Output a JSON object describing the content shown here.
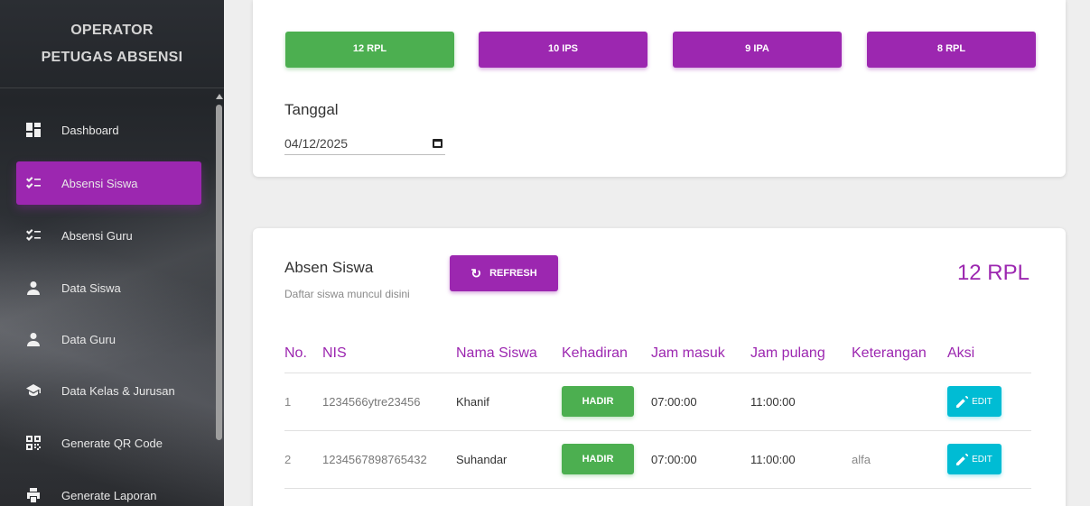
{
  "sidebar": {
    "brand_line1": "OPERATOR",
    "brand_line2": "PETUGAS ABSENSI",
    "items": [
      {
        "label": "Dashboard",
        "icon": "dashboard-icon"
      },
      {
        "label": "Absensi Siswa",
        "icon": "checklist-icon",
        "active": true
      },
      {
        "label": "Absensi Guru",
        "icon": "checklist-icon"
      },
      {
        "label": "Data Siswa",
        "icon": "person-icon"
      },
      {
        "label": "Data Guru",
        "icon": "person-icon"
      },
      {
        "label": "Data Kelas & Jurusan",
        "icon": "school-icon"
      },
      {
        "label": "Generate QR Code",
        "icon": "qr-code-icon"
      },
      {
        "label": "Generate Laporan",
        "icon": "printer-icon"
      }
    ]
  },
  "classes": [
    "12 RPL",
    "10 IPS",
    "9 IPA",
    "8 RPL"
  ],
  "date": {
    "label": "Tanggal",
    "value": "04/12/2025"
  },
  "absen": {
    "title": "Absen Siswa",
    "subtitle": "Daftar siswa muncul disini",
    "refresh_label": "REFRESH",
    "class_name": "12 RPL"
  },
  "table": {
    "headers": [
      "No.",
      "NIS",
      "Nama Siswa",
      "Kehadiran",
      "Jam masuk",
      "Jam pulang",
      "Keterangan",
      "Aksi"
    ],
    "rows": [
      {
        "no": "1",
        "nis": "1234566ytre23456",
        "nama": "Khanif",
        "kehadiran": "HADIR",
        "jam_masuk": "07:00:00",
        "jam_pulang": "11:00:00",
        "keterangan": "",
        "aksi": "EDIT"
      },
      {
        "no": "2",
        "nis": "1234567898765432",
        "nama": "Suhandar",
        "kehadiran": "HADIR",
        "jam_masuk": "07:00:00",
        "jam_pulang": "11:00:00",
        "keterangan": "alfa",
        "aksi": "EDIT"
      }
    ]
  },
  "colors": {
    "purple": "#9c27b0",
    "green": "#4caf50",
    "cyan": "#00bcd4"
  }
}
